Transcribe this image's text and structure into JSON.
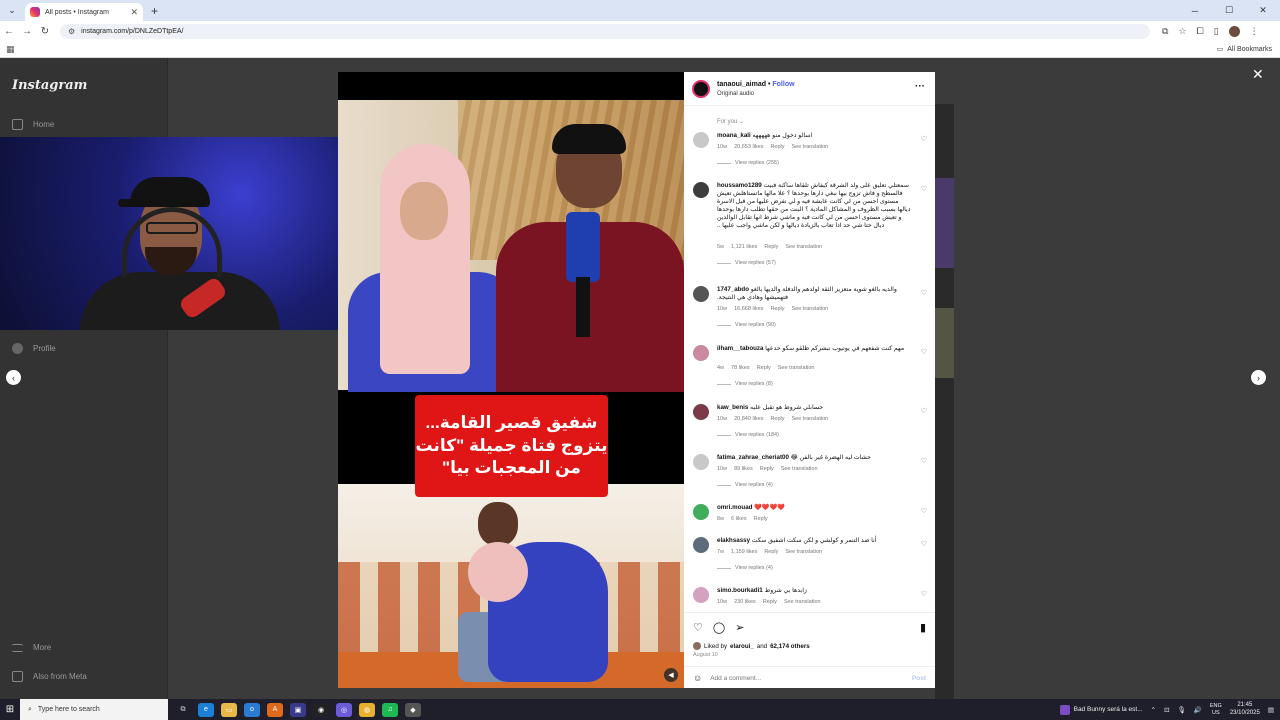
{
  "browser": {
    "tab_title": "All posts • Instagram",
    "url": "instagram.com/p/DNLZeDTtpEA/",
    "bookmarks_label": "All Bookmarks"
  },
  "sidebar": {
    "logo": "Instagram",
    "home_label": "Home",
    "profile_label": "Profile",
    "more_label": "More",
    "meta_label": "Also from Meta"
  },
  "post": {
    "caption_line1": "شفيق قصير القامة...",
    "caption_line2": "يتزوج فتاة جميلة \"كانت",
    "caption_line3": "من المعجبات بيا\""
  },
  "panel": {
    "username": "tanaoui_aimad",
    "follow_label": "Follow",
    "audio": "Original audio",
    "for_you": "For you ⌄",
    "comments": [
      {
        "user": "moana_kali",
        "text": "اسالو دخول منو هههههه",
        "age": "10w",
        "likes": "20,653 likes",
        "reply": "Reply",
        "translate": "See translation",
        "replies": "View replies (255)",
        "color": "#c8c8c8"
      },
      {
        "user": "houssamo1289",
        "text": "سمعتلي تعليق على ولد الشرقة كيفاش تلقاها ساكنة فبيت فالسطح و فاش تزوج بيها نبغي دارها بوحدها ؟ علا مالها ماتستاهلش تعيش مستوى احسن من لي كانت عايشة فيه و لي نفرض عليها من قبل الاسرة ديالها بسبب الظروف و المشاكل المادية ؟ البنت من حقها تطلب دارها بوحدها و تعيش مستوى احسن من لي كانت فيه و ماشي شرط انها تقابل الوالدين ديال حتا شي حد ادا تعاب بالزيادة ديالها و لكن ماشي واجب عليها ..",
        "age": "5w",
        "likes": "1,121 likes",
        "reply": "Reply",
        "translate": "See translation",
        "replies": "View replies (57)",
        "color": "#3d3d3d"
      },
      {
        "user": "1747_abdo",
        "text": "والديه بالغو شوية متعزيز الثقة لولدهم والدفلة والديها بالغو فتهميشها وهادي هي النتيجة.",
        "age": "10w",
        "likes": "16,668 likes",
        "reply": "Reply",
        "translate": "See translation",
        "replies": "View replies (90)",
        "color": "#555"
      },
      {
        "user": "ilham__tabouza",
        "text": "مهم كنت شفعهم في يوتيوب نبشركم ظلقو سكو حدعها",
        "age": "4w",
        "likes": "78 likes",
        "reply": "Reply",
        "translate": "See translation",
        "replies": "View replies (8)",
        "color": "#c98aa0"
      },
      {
        "user": "kaw_benis",
        "text": "حسابلي شروط هو تقبل عليه",
        "age": "10w",
        "likes": "20,840 likes",
        "reply": "Reply",
        "translate": "See translation",
        "replies": "View replies (184)",
        "color": "#7a3a4a"
      },
      {
        "user": "fatima_zahrae_cheriat00",
        "text": "حشات ليه الهضرة غير بالفن 😂",
        "age": "10w",
        "likes": "89 likes",
        "reply": "Reply",
        "translate": "See translation",
        "replies": "View replies (4)",
        "color": "#c8c8c8"
      },
      {
        "user": "omri.mouad",
        "text": "❤️❤️❤️❤️",
        "age": "8w",
        "likes": "6 likes",
        "reply": "Reply",
        "translate": "",
        "replies": "",
        "color": "#3fae5a"
      },
      {
        "user": "elakhsassy",
        "text": "أنا ضد التنمر و كولشي و لكن سكت اشفيق سكت",
        "age": "7w",
        "likes": "1,159 likes",
        "reply": "Reply",
        "translate": "See translation",
        "replies": "View replies (4)",
        "color": "#5d6b7a"
      },
      {
        "user": "simo.bourkadi1",
        "text": "زابدها بي شروط",
        "age": "10w",
        "likes": "230 likes",
        "reply": "Reply",
        "translate": "See translation",
        "replies": "",
        "color": "#d6a0c0"
      }
    ],
    "liked_by_prefix": "Liked by",
    "liked_by_user": "elaroui_",
    "liked_by_and": "and",
    "liked_by_others": "62,174 others",
    "date": "August 10",
    "add_comment_placeholder": "Add a comment...",
    "post_label": "Post"
  },
  "taskbar": {
    "search_placeholder": "Type here to search",
    "now_playing": "Bad Bunny será la est...",
    "lang1": "ENG",
    "lang2": "US",
    "time": "21:45",
    "date": "23/10/2025"
  }
}
